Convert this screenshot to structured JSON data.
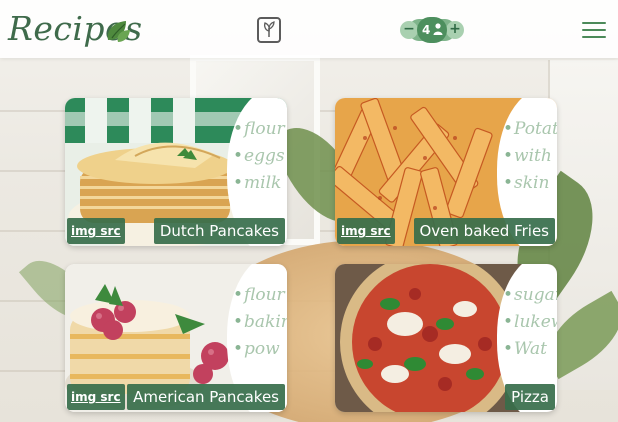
{
  "header": {
    "logo_text": "Recipes",
    "servings_count": "4",
    "minus_symbol": "−",
    "plus_symbol": "+"
  },
  "cards": [
    {
      "title": "Dutch Pancakes",
      "img_src_label": "img src",
      "ingredients": [
        "flour",
        "eggs",
        "milk"
      ]
    },
    {
      "title": "Oven baked Fries",
      "img_src_label": "img src",
      "ingredients": [
        "Potato",
        "with",
        "skin"
      ]
    },
    {
      "title": "American Pancakes",
      "img_src_label": "img src",
      "ingredients": [
        "flour",
        "bakin",
        "pow"
      ]
    },
    {
      "title": "Pizza",
      "img_src_label": "",
      "ingredients": [
        "sugar",
        "lukew",
        "Wat"
      ]
    }
  ],
  "colors": {
    "brand_green": "#3f6b4b",
    "accent_green": "#4d8f5e",
    "label_bg": "#376e4b",
    "ingredient_text": "#a9c6ad"
  },
  "icons": {
    "logo": "basil-leaf-icon",
    "center": "vegetarian-leaf-icon",
    "servings": "person-icon",
    "menu": "hamburger-menu-icon"
  }
}
